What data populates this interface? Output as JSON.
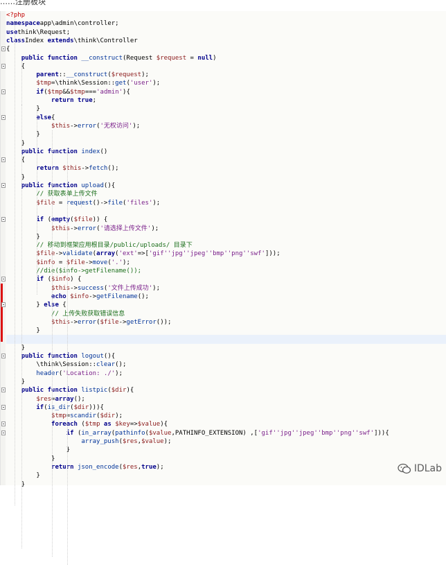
{
  "caption": "……注册板块",
  "watermark": {
    "text": "IDLab",
    "icon": "wechat-icon"
  },
  "code_lines": [
    {
      "segments": [
        [
          "tg",
          "<?php"
        ]
      ]
    },
    {
      "segments": [
        [
          "kw",
          "namespace"
        ],
        [
          "",
          "app\\admin\\controller;"
        ]
      ]
    },
    {
      "segments": [
        [
          "kw",
          "use"
        ],
        [
          "",
          "think\\Request;"
        ]
      ]
    },
    {
      "segments": [
        [
          "kw",
          "class"
        ],
        [
          "",
          "Index "
        ],
        [
          "kw",
          "extends"
        ],
        [
          "",
          "\\think\\Controller"
        ]
      ]
    },
    {
      "segments": [
        [
          "",
          "{"
        ]
      ]
    },
    {
      "segments": [
        [
          "",
          "    "
        ],
        [
          "kw",
          "public function"
        ],
        [
          "fn",
          " __construct"
        ],
        [
          "",
          "(Request "
        ],
        [
          "vr",
          "$request"
        ],
        [
          "",
          " = "
        ],
        [
          "kw",
          "null"
        ],
        [
          "",
          ")"
        ]
      ]
    },
    {
      "segments": [
        [
          "",
          "    {"
        ]
      ]
    },
    {
      "segments": [
        [
          "",
          "        "
        ],
        [
          "kw",
          "parent"
        ],
        [
          "",
          "::"
        ],
        [
          "fn",
          "__construct"
        ],
        [
          "",
          "("
        ],
        [
          "vr",
          "$request"
        ],
        [
          "",
          ");"
        ]
      ]
    },
    {
      "segments": [
        [
          "",
          "        "
        ],
        [
          "vr",
          "$tmp"
        ],
        [
          "",
          "=\\think\\Session::"
        ],
        [
          "fn",
          "get"
        ],
        [
          "",
          "("
        ],
        [
          "st",
          "'user'"
        ],
        [
          "",
          ");"
        ]
      ]
    },
    {
      "segments": [
        [
          "",
          "        "
        ],
        [
          "kw",
          "if"
        ],
        [
          "",
          "("
        ],
        [
          "vr",
          "$tmp"
        ],
        [
          "",
          "&&"
        ],
        [
          "vr",
          "$tmp"
        ],
        [
          "",
          "==="
        ],
        [
          "st",
          "'admin'"
        ],
        [
          "",
          "){"
        ]
      ]
    },
    {
      "segments": [
        [
          "",
          "            "
        ],
        [
          "kw",
          "return true"
        ],
        [
          "",
          ";"
        ]
      ]
    },
    {
      "segments": [
        [
          "",
          "        }"
        ]
      ]
    },
    {
      "segments": [
        [
          "",
          "        "
        ],
        [
          "kw",
          "else"
        ],
        [
          "",
          "{"
        ]
      ]
    },
    {
      "segments": [
        [
          "",
          "            "
        ],
        [
          "vr",
          "$this"
        ],
        [
          "",
          "->"
        ],
        [
          "fn",
          "error"
        ],
        [
          "",
          "("
        ],
        [
          "st",
          "'无权访问'"
        ],
        [
          "",
          ");"
        ]
      ]
    },
    {
      "segments": [
        [
          "",
          "        }"
        ]
      ]
    },
    {
      "segments": [
        [
          "",
          "    }"
        ]
      ]
    },
    {
      "segments": [
        [
          "",
          "    "
        ],
        [
          "kw",
          "public function"
        ],
        [
          "fn",
          " index"
        ],
        [
          "",
          "()"
        ]
      ]
    },
    {
      "segments": [
        [
          "",
          "    {"
        ]
      ]
    },
    {
      "segments": [
        [
          "",
          "        "
        ],
        [
          "kw",
          "return"
        ],
        [
          "",
          ""
        ],
        [
          "vr",
          " $this"
        ],
        [
          "",
          "->"
        ],
        [
          "fn",
          "fetch"
        ],
        [
          "",
          "();"
        ]
      ]
    },
    {
      "segments": [
        [
          "",
          "    }"
        ]
      ]
    },
    {
      "segments": [
        [
          "",
          "    "
        ],
        [
          "kw",
          "public function"
        ],
        [
          "fn",
          " upload"
        ],
        [
          "",
          "(){"
        ]
      ]
    },
    {
      "segments": [
        [
          "",
          "        "
        ],
        [
          "cm",
          "// 获取表单上传文件"
        ]
      ]
    },
    {
      "segments": [
        [
          "",
          "        "
        ],
        [
          "vr",
          "$file"
        ],
        [
          "",
          " = "
        ],
        [
          "fn",
          "request"
        ],
        [
          "",
          "()->"
        ],
        [
          "fn",
          "file"
        ],
        [
          "",
          "("
        ],
        [
          "st",
          "'files'"
        ],
        [
          "",
          ");"
        ]
      ]
    },
    {
      "segments": [
        [
          "",
          ""
        ]
      ]
    },
    {
      "segments": [
        [
          "",
          "        "
        ],
        [
          "kw",
          "if"
        ],
        [
          "",
          " ("
        ],
        [
          "kw",
          "empty"
        ],
        [
          "",
          "("
        ],
        [
          "vr",
          "$file"
        ],
        [
          "",
          ")) {"
        ]
      ]
    },
    {
      "segments": [
        [
          "",
          "            "
        ],
        [
          "vr",
          "$this"
        ],
        [
          "",
          "->"
        ],
        [
          "fn",
          "error"
        ],
        [
          "",
          "("
        ],
        [
          "st",
          "'请选择上传文件'"
        ],
        [
          "",
          ");"
        ]
      ]
    },
    {
      "segments": [
        [
          "",
          "        }"
        ]
      ]
    },
    {
      "segments": [
        [
          "",
          "        "
        ],
        [
          "cm",
          "// 移动到框架应用根目录/public/uploads/ 目录下"
        ]
      ]
    },
    {
      "segments": [
        [
          "",
          "        "
        ],
        [
          "vr",
          "$file"
        ],
        [
          "",
          "->"
        ],
        [
          "fn",
          "validate"
        ],
        [
          "",
          "("
        ],
        [
          "kw",
          "array"
        ],
        [
          "",
          "("
        ],
        [
          "st",
          "'ext'"
        ],
        [
          "",
          "=>["
        ],
        [
          "st",
          "'gif'"
        ],
        [
          ", ",
          ""
        ],
        [
          "st",
          "'jpg'"
        ],
        [
          ", ",
          ""
        ],
        [
          "st",
          "'jpeg'"
        ],
        [
          ", ",
          ""
        ],
        [
          "st",
          "'bmp'"
        ],
        [
          ", ",
          ""
        ],
        [
          "st",
          "'png'"
        ],
        [
          ", ",
          ""
        ],
        [
          "st",
          "'swf'"
        ],
        [
          "",
          "]));"
        ]
      ]
    },
    {
      "segments": [
        [
          "",
          "        "
        ],
        [
          "vr",
          "$info"
        ],
        [
          "",
          " = "
        ],
        [
          "vr",
          "$file"
        ],
        [
          "",
          "->"
        ],
        [
          "fn",
          "move"
        ],
        [
          "",
          "("
        ],
        [
          "st",
          "'.'"
        ],
        [
          "",
          ");"
        ]
      ]
    },
    {
      "segments": [
        [
          "",
          "        "
        ],
        [
          "cm",
          "//die($info->getFilename());"
        ]
      ]
    },
    {
      "segments": [
        [
          "",
          "        "
        ],
        [
          "kw",
          "if"
        ],
        [
          "",
          " ("
        ],
        [
          "vr",
          "$info"
        ],
        [
          "",
          ") {"
        ]
      ]
    },
    {
      "segments": [
        [
          "",
          "            "
        ],
        [
          "vr",
          "$this"
        ],
        [
          "",
          "->"
        ],
        [
          "fn",
          "success"
        ],
        [
          "",
          "("
        ],
        [
          "st",
          "'文件上传成功'"
        ],
        [
          "",
          ");"
        ]
      ]
    },
    {
      "segments": [
        [
          "",
          "            "
        ],
        [
          "kw",
          "echo"
        ],
        [
          "",
          ""
        ],
        [
          "vr",
          " $info"
        ],
        [
          "",
          "->"
        ],
        [
          "fn",
          "getFilename"
        ],
        [
          "",
          "();"
        ]
      ]
    },
    {
      "segments": [
        [
          "",
          "        } "
        ],
        [
          "kw",
          "else"
        ],
        [
          "",
          " {"
        ]
      ]
    },
    {
      "segments": [
        [
          "",
          "            "
        ],
        [
          "cm",
          "// 上传失败获取错误信息"
        ]
      ]
    },
    {
      "segments": [
        [
          "",
          "            "
        ],
        [
          "vr",
          "$this"
        ],
        [
          "",
          "->"
        ],
        [
          "fn",
          "error"
        ],
        [
          "",
          "("
        ],
        [
          "vr",
          "$file"
        ],
        [
          "",
          "->"
        ],
        [
          "fn",
          "getError"
        ],
        [
          "",
          "());"
        ]
      ]
    },
    {
      "segments": [
        [
          "",
          "        }"
        ]
      ]
    },
    {
      "segments": [
        [
          "",
          ""
        ]
      ]
    },
    {
      "segments": [
        [
          "",
          "    }"
        ]
      ]
    },
    {
      "segments": [
        [
          "",
          "    "
        ],
        [
          "kw",
          "public function"
        ],
        [
          "fn",
          " logout"
        ],
        [
          "",
          "(){"
        ]
      ]
    },
    {
      "segments": [
        [
          "",
          "        \\think\\Session::"
        ],
        [
          "fn",
          "clear"
        ],
        [
          "",
          "();"
        ]
      ]
    },
    {
      "segments": [
        [
          "",
          "        "
        ],
        [
          "fn",
          "header"
        ],
        [
          "",
          "("
        ],
        [
          "st",
          "'Location: ./'"
        ],
        [
          "",
          ");"
        ]
      ]
    },
    {
      "segments": [
        [
          "",
          "    }"
        ]
      ]
    },
    {
      "segments": [
        [
          "",
          "    "
        ],
        [
          "kw",
          "public function"
        ],
        [
          "fn",
          " listpic"
        ],
        [
          "",
          "("
        ],
        [
          "vr",
          "$dir"
        ],
        [
          "",
          "){"
        ]
      ]
    },
    {
      "segments": [
        [
          "",
          "        "
        ],
        [
          "vr",
          "$res"
        ],
        [
          "",
          "="
        ],
        [
          "kw",
          "array"
        ],
        [
          "",
          "();"
        ]
      ]
    },
    {
      "segments": [
        [
          "",
          "        "
        ],
        [
          "kw",
          "if"
        ],
        [
          "",
          "("
        ],
        [
          "fn",
          "is_dir"
        ],
        [
          "",
          "("
        ],
        [
          "vr",
          "$dir"
        ],
        [
          "",
          "))){"
        ]
      ]
    },
    {
      "segments": [
        [
          "",
          "            "
        ],
        [
          "vr",
          "$tmp"
        ],
        [
          "",
          "="
        ],
        [
          "fn",
          "scandir"
        ],
        [
          "",
          "("
        ],
        [
          "vr",
          "$dir"
        ],
        [
          "",
          ");"
        ]
      ]
    },
    {
      "segments": [
        [
          "",
          "            "
        ],
        [
          "kw",
          "foreach"
        ],
        [
          "",
          " ("
        ],
        [
          "vr",
          "$tmp"
        ],
        [
          "kw",
          " as "
        ],
        [
          "vr",
          "$key"
        ],
        [
          "",
          "=>"
        ],
        [
          "vr",
          "$value"
        ],
        [
          "",
          "){"
        ]
      ]
    },
    {
      "segments": [
        [
          "",
          "                "
        ],
        [
          "kw",
          "if"
        ],
        [
          "",
          " ("
        ],
        [
          "fn",
          "in_array"
        ],
        [
          "",
          "("
        ],
        [
          "fn",
          "pathinfo"
        ],
        [
          "",
          "("
        ],
        [
          "vr",
          "$value"
        ],
        [
          "",
          ",PATHINFO_EXTENSION) ,["
        ],
        [
          "st",
          "'gif'"
        ],
        [
          ", ",
          ""
        ],
        [
          "st",
          "'jpg'"
        ],
        [
          ", ",
          ""
        ],
        [
          "st",
          "'jpeg'"
        ],
        [
          ", ",
          ""
        ],
        [
          "st",
          "'bmp'"
        ],
        [
          ", ",
          ""
        ],
        [
          "st",
          "'png'"
        ],
        [
          ", ",
          ""
        ],
        [
          "st",
          "'swf'"
        ],
        [
          "",
          "])){"
        ]
      ]
    },
    {
      "segments": [
        [
          "",
          "                    "
        ],
        [
          "fn",
          "array_push"
        ],
        [
          "",
          "("
        ],
        [
          "vr",
          "$res"
        ],
        [
          "",
          ","
        ],
        [
          "vr",
          "$value"
        ],
        [
          "",
          ");"
        ]
      ]
    },
    {
      "segments": [
        [
          "",
          "                }"
        ]
      ]
    },
    {
      "segments": [
        [
          "",
          "            }"
        ]
      ]
    },
    {
      "segments": [
        [
          "",
          "            "
        ],
        [
          "kw",
          "return"
        ],
        [
          "fn",
          " json_encode"
        ],
        [
          "",
          "("
        ],
        [
          "vr",
          "$res"
        ],
        [
          "",
          ","
        ],
        [
          "kw",
          "true"
        ],
        [
          "",
          ");"
        ]
      ]
    },
    {
      "segments": [
        [
          "",
          "        }"
        ]
      ]
    },
    {
      "segments": [
        [
          "",
          "    }"
        ]
      ]
    }
  ]
}
